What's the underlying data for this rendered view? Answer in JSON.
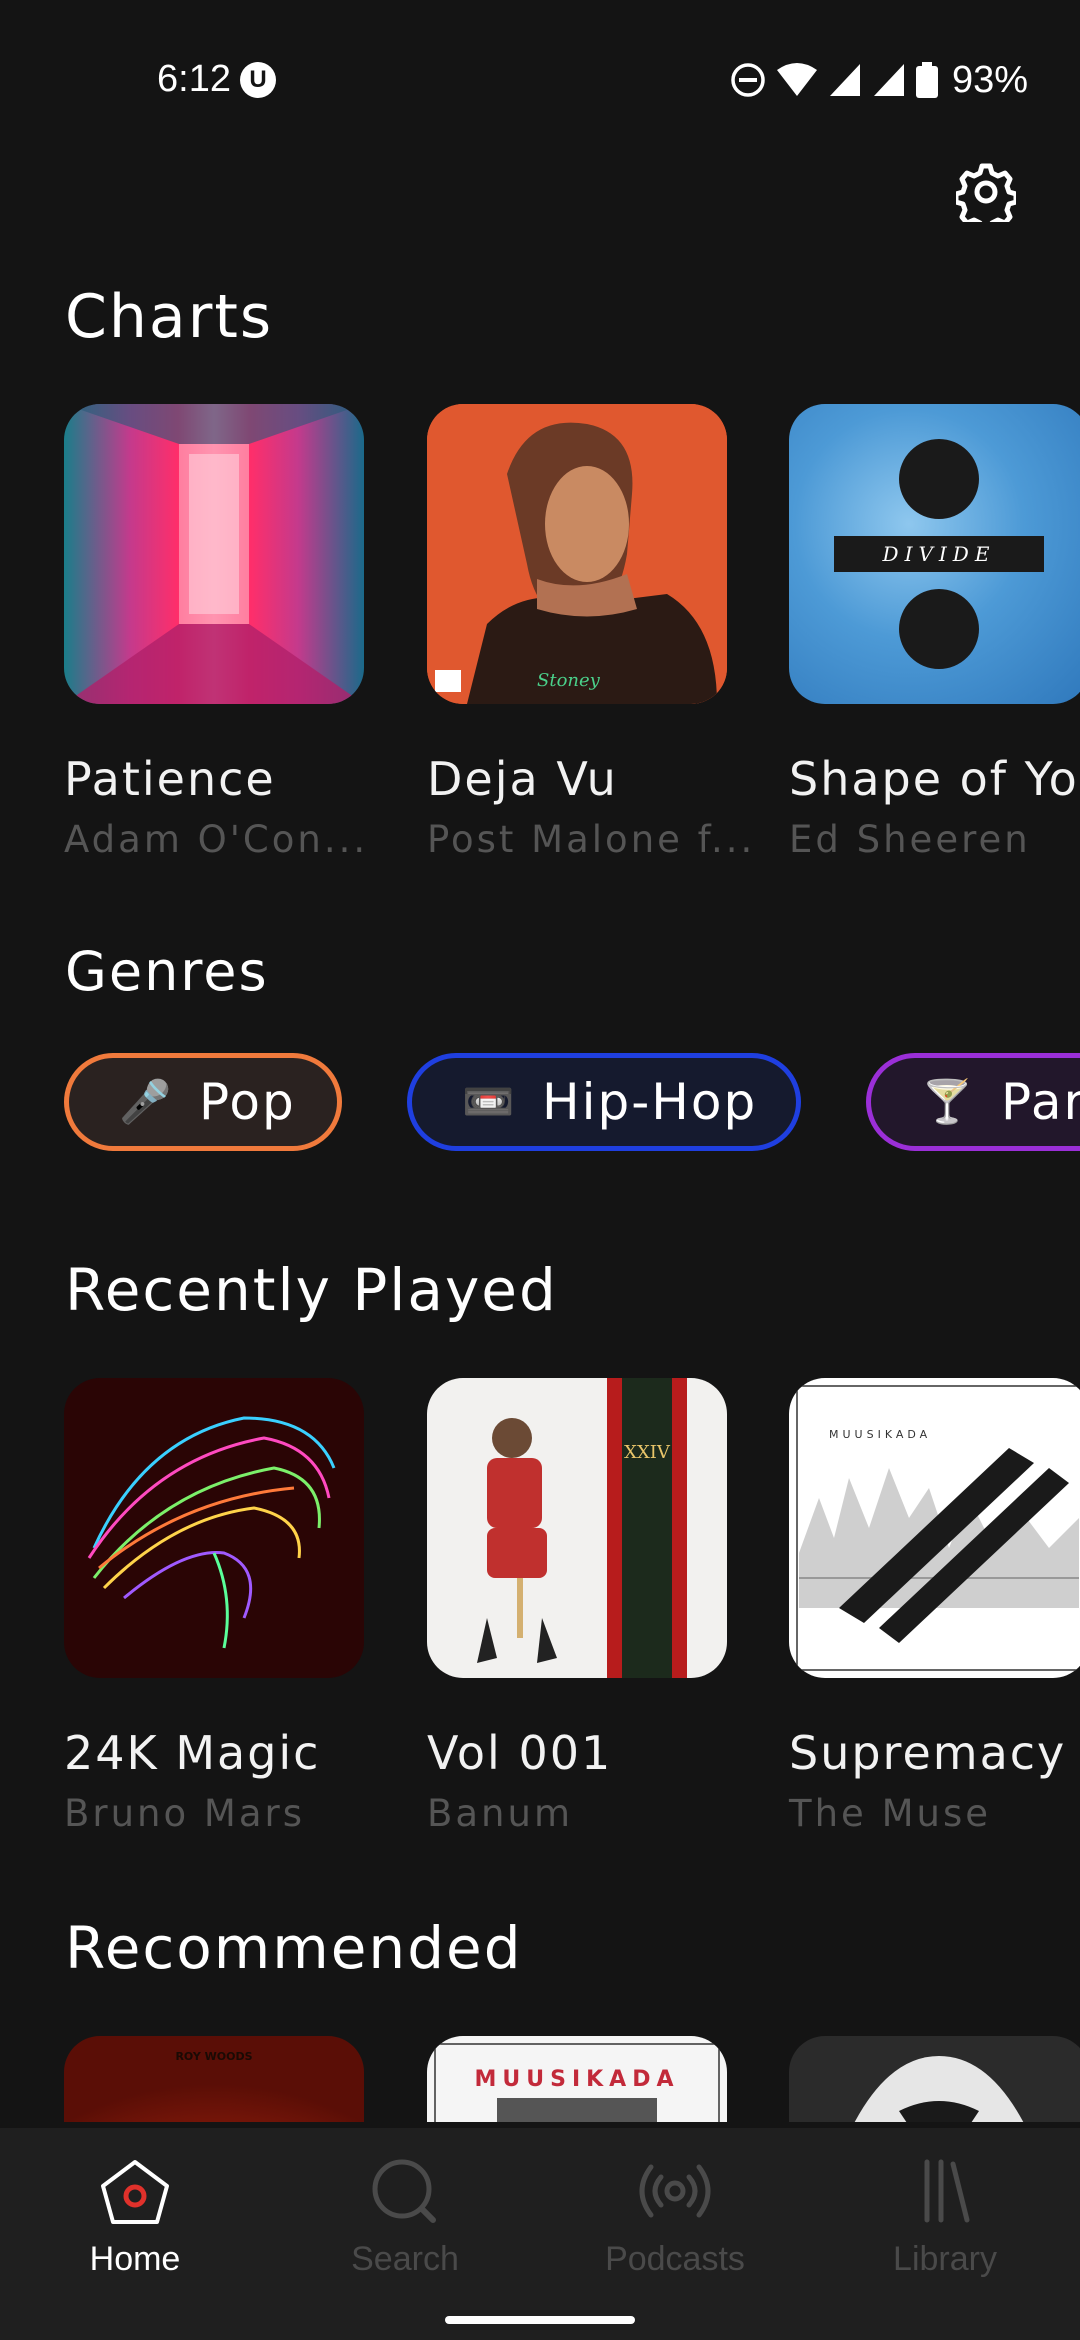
{
  "status_bar": {
    "time": "6:12",
    "battery": "93%"
  },
  "charts": {
    "title": "Charts",
    "items": [
      {
        "title": "Patience",
        "artist": "Adam O'Con..."
      },
      {
        "title": "Deja Vu",
        "artist": "Post Malone f..."
      },
      {
        "title": "Shape of Yo...",
        "artist": "Ed Sheeren"
      }
    ],
    "album_text_2": "DIVIDE"
  },
  "genres": {
    "title": "Genres",
    "items": [
      {
        "label": "Pop",
        "emoji": "🎤",
        "color": "#f07a3c"
      },
      {
        "label": "Hip-Hop",
        "emoji": "📼",
        "color": "#1f3fe0"
      },
      {
        "label": "Party",
        "emoji": "🍸",
        "color": "#9b2fd8"
      }
    ]
  },
  "recently_played": {
    "title": "Recently Played",
    "items": [
      {
        "title": "24K Magic",
        "artist": "Bruno Mars"
      },
      {
        "title": "Vol 001",
        "artist": "Banum"
      },
      {
        "title": "Supremacy",
        "artist": "The Muse"
      }
    ],
    "album_text_1": "XXIV",
    "album_text_2": "MUUSIKADA"
  },
  "recommended": {
    "title": "Recommended",
    "album_text_0": "ROY WOODS",
    "album_text_1": "MUUSIKADA"
  },
  "bottom_nav": {
    "items": [
      {
        "label": "Home",
        "active": true
      },
      {
        "label": "Search",
        "active": false
      },
      {
        "label": "Podcasts",
        "active": false
      },
      {
        "label": "Library",
        "active": false
      }
    ]
  },
  "colors": {
    "background": "#141414",
    "accent": "#e0312b",
    "inactive": "#4a4a4a"
  }
}
